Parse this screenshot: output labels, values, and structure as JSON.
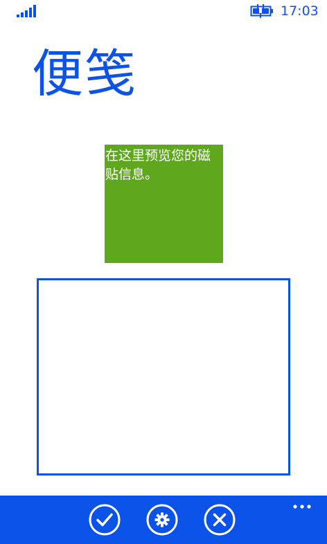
{
  "status_bar": {
    "time": "17:03",
    "signal_icon": "signal-strength-icon",
    "battery_icon": "battery-charging-icon"
  },
  "page": {
    "title": "便笺"
  },
  "tile_preview": {
    "text": "在这里预览您的磁贴信息。",
    "color": "#5fa81e"
  },
  "note_input": {
    "value": "",
    "placeholder": ""
  },
  "app_bar": {
    "color": "#0a52e8",
    "buttons": [
      {
        "icon": "check-icon"
      },
      {
        "icon": "gear-icon"
      },
      {
        "icon": "close-icon"
      }
    ],
    "more_icon": "more-ellipsis-icon"
  },
  "colors": {
    "accent": "#0a52e8",
    "tile": "#5fa81e",
    "background": "#ffffff"
  }
}
